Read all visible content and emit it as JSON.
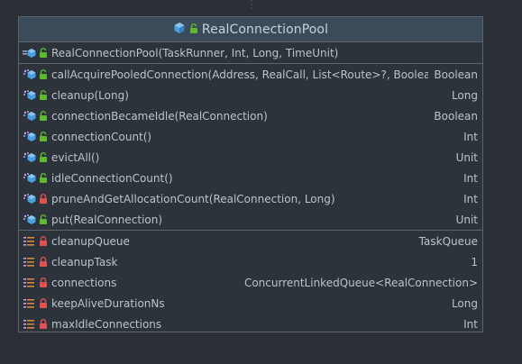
{
  "class_name": "RealConnectionPool",
  "constructor": {
    "name": "RealConnectionPool(TaskRunner, Int, Long, TimeUnit)",
    "type": "",
    "icons": [
      "constructor-icon",
      "public-lock-icon"
    ]
  },
  "methods": [
    {
      "name": "callAcquirePooledConnection(Address, RealCall, List<Route>?, Boolean)",
      "type": "Boolean",
      "visibility": "public"
    },
    {
      "name": "cleanup(Long)",
      "type": "Long",
      "visibility": "public"
    },
    {
      "name": "connectionBecameIdle(RealConnection)",
      "type": "Boolean",
      "visibility": "public"
    },
    {
      "name": "connectionCount()",
      "type": "Int",
      "visibility": "public"
    },
    {
      "name": "evictAll()",
      "type": "Unit",
      "visibility": "public"
    },
    {
      "name": "idleConnectionCount()",
      "type": "Int",
      "visibility": "public"
    },
    {
      "name": "pruneAndGetAllocationCount(RealConnection, Long)",
      "type": "Int",
      "visibility": "private"
    },
    {
      "name": "put(RealConnection)",
      "type": "Unit",
      "visibility": "public"
    }
  ],
  "fields": [
    {
      "name": "cleanupQueue",
      "type": "TaskQueue",
      "visibility": "private"
    },
    {
      "name": "cleanupTask",
      "type": "1",
      "visibility": "private"
    },
    {
      "name": "connections",
      "type": "ConcurrentLinkedQueue<RealConnection>",
      "visibility": "private"
    },
    {
      "name": "keepAliveDurationNs",
      "type": "Long",
      "visibility": "private"
    },
    {
      "name": "maxIdleConnections",
      "type": "Int",
      "visibility": "private"
    }
  ],
  "colors": {
    "class_icon": "#4a9fe0",
    "public_lock": "#5fb832",
    "private_lock": "#e05252",
    "method_icon": "#c9a2e8",
    "field_icon": "#d7873a"
  }
}
